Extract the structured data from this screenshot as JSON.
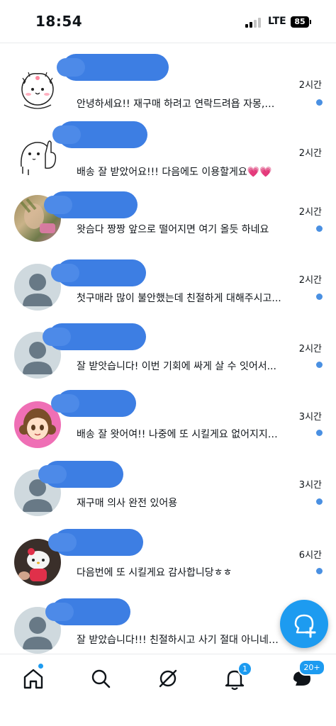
{
  "status_bar": {
    "time": "18:54",
    "network": "LTE",
    "battery": "85"
  },
  "messages": [
    {
      "time": "2시간",
      "preview": "안녕하세요!! 재구매 하려고 연락드려욥 자몽,…"
    },
    {
      "time": "2시간",
      "preview": "배송 잘 받았어요!!!  다음에도 이용할게요💗💗"
    },
    {
      "time": "2시간",
      "preview": "왓슴다 짱짱 앞으로 떨어지면 여기 올듯 하네요"
    },
    {
      "time": "2시간",
      "preview": "첫구매라 많이 불안했는데 친절하게 대해주시고..."
    },
    {
      "time": "2시간",
      "preview": "잘 받앗습니다! 이번 기회에 싸게 살 수 잇어서..."
    },
    {
      "time": "3시간",
      "preview": "배송 잘 왓어여!! 나중에 또 시킬게요 없어지지…"
    },
    {
      "time": "3시간",
      "preview": "재구매 의사 완전 있어용"
    },
    {
      "time": "6시간",
      "preview": "다음번에 또 시킬게요 감사합니당ㅎㅎ"
    },
    {
      "time": "",
      "preview": "잘 받았습니다!!! 친절하시고 사기 절대 아니네…"
    }
  ],
  "tabbar": {
    "notifications_badge": "1",
    "messages_badge": "20+",
    "icons": [
      "home-icon",
      "search-icon",
      "grok-icon",
      "bell-icon",
      "envelope-icon"
    ]
  },
  "fab": {
    "icon": "new-message-icon"
  },
  "colors": {
    "accent": "#1d9bf0",
    "unread_dot": "#4a90e2",
    "name_redaction": "#3d7ee3"
  }
}
